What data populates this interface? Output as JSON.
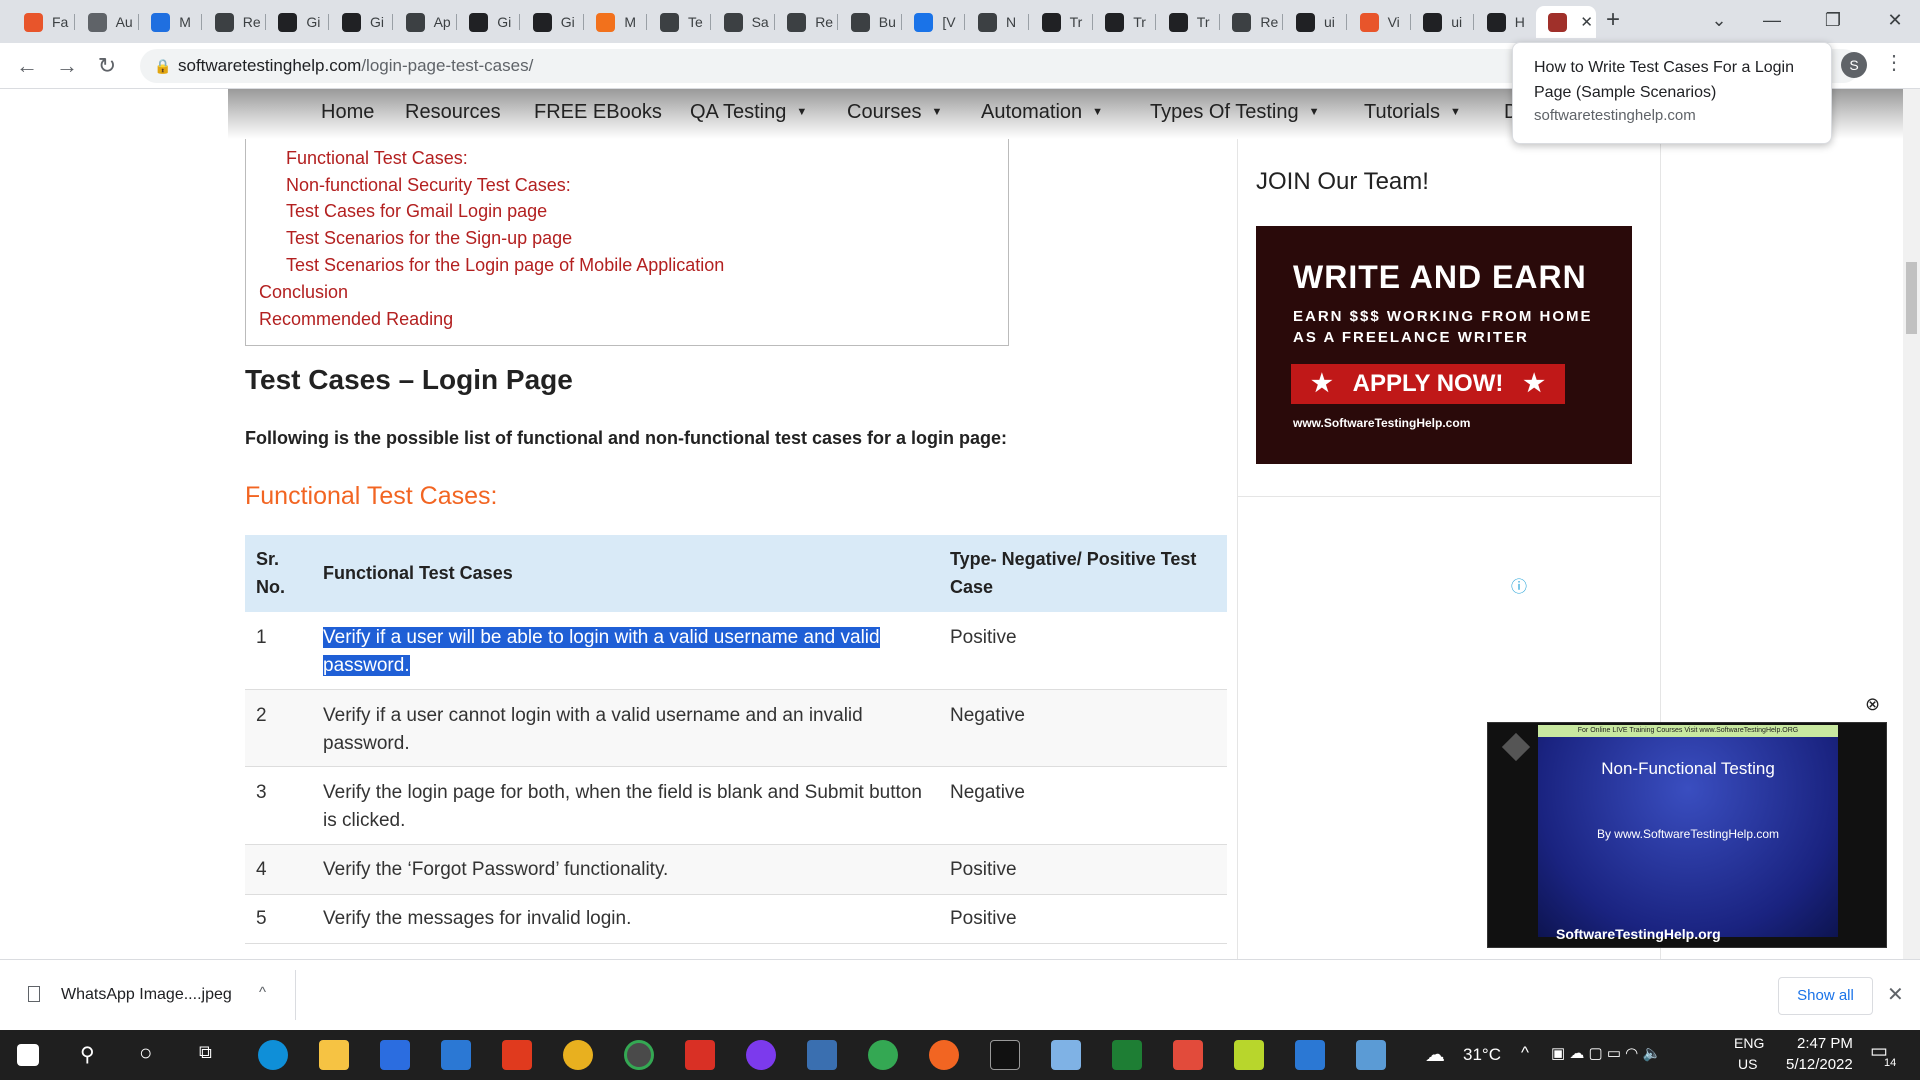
{
  "browser": {
    "tabs": [
      {
        "label": "Fa",
        "icon": "settings-tab-icon",
        "color": "#e8552b"
      },
      {
        "label": "Au",
        "icon": "web-icon",
        "color": "#5f6368"
      },
      {
        "label": "M",
        "icon": "k-icon",
        "color": "#1f6fe0"
      },
      {
        "label": "Re",
        "icon": "tab-icon",
        "color": "#3c4043"
      },
      {
        "label": "Gi",
        "icon": "github-icon",
        "color": "#202124"
      },
      {
        "label": "Gi",
        "icon": "github-icon",
        "color": "#202124"
      },
      {
        "label": "Ap",
        "icon": "tab-icon",
        "color": "#3c4043"
      },
      {
        "label": "Gi",
        "icon": "github-icon",
        "color": "#202124"
      },
      {
        "label": "Gi",
        "icon": "github-icon",
        "color": "#202124"
      },
      {
        "label": "M",
        "icon": "orange-icon",
        "color": "#f2711c"
      },
      {
        "label": "Te",
        "icon": "tab-icon",
        "color": "#3c4043"
      },
      {
        "label": "Sa",
        "icon": "tab-icon",
        "color": "#3c4043"
      },
      {
        "label": "Re",
        "icon": "tab-icon",
        "color": "#3c4043"
      },
      {
        "label": "Bu",
        "icon": "tab-icon",
        "color": "#3c4043"
      },
      {
        "label": "[V",
        "icon": "diamond-icon",
        "color": "#1a73e8"
      },
      {
        "label": "N",
        "icon": "tab-icon",
        "color": "#3c4043"
      },
      {
        "label": "Tr",
        "icon": "tab-icon",
        "color": "#202124"
      },
      {
        "label": "Tr",
        "icon": "tab-icon",
        "color": "#202124"
      },
      {
        "label": "Tr",
        "icon": "tab-icon",
        "color": "#202124"
      },
      {
        "label": "Re",
        "icon": "tab-icon",
        "color": "#3c4043"
      },
      {
        "label": "ui",
        "icon": "github-icon",
        "color": "#202124"
      },
      {
        "label": "Vi",
        "icon": "colorful-icon",
        "color": "#e8552b"
      },
      {
        "label": "ui",
        "icon": "github-icon",
        "color": "#202124"
      },
      {
        "label": "H",
        "icon": "sth-icon",
        "color": "#202124"
      }
    ],
    "active_tab_icon_color": "#a0302a",
    "url_host": "softwaretestinghelp.com",
    "url_path": "/login-page-test-cases/",
    "profile_initial": "S",
    "tooltip": {
      "title": "How to Write Test Cases For a Login Page (Sample Scenarios)",
      "domain": "softwaretestinghelp.com"
    }
  },
  "site_nav": {
    "items": [
      "Home",
      "Resources",
      "FREE EBooks",
      "QA Testing",
      "Courses",
      "Automation",
      "Types Of Testing",
      "Tutorials",
      "D"
    ]
  },
  "toc": {
    "links": [
      "Functional Test Cases:",
      "Non-functional Security Test Cases:",
      "Test Cases for Gmail Login page",
      "Test Scenarios for the Sign-up page",
      "Test Scenarios for the Login page of Mobile Application",
      "Conclusion",
      "Recommended Reading"
    ]
  },
  "article": {
    "heading": "Test Cases – Login Page",
    "intro": "Following is the possible list of functional and non-functional test cases for a login page:",
    "subheading": "Functional Test Cases:",
    "table": {
      "headers": [
        "Sr. No.",
        "Functional Test Cases",
        "Type- Negative/ Positive Test Case"
      ],
      "rows": [
        {
          "no": "1",
          "case": "Verify if a user will be able to login with a valid username and valid password.",
          "type": "Positive"
        },
        {
          "no": "2",
          "case": "Verify if a user cannot login with a valid username and an invalid password.",
          "type": "Negative"
        },
        {
          "no": "3",
          "case": "Verify the login page for both, when the field is blank and Submit button is clicked.",
          "type": "Negative"
        },
        {
          "no": "4",
          "case": "Verify the ‘Forgot Password’ functionality.",
          "type": "Positive"
        },
        {
          "no": "5",
          "case": "Verify the messages for invalid login.",
          "type": "Positive"
        }
      ]
    }
  },
  "sidebar": {
    "join_title": "JOIN Our Team!",
    "ad": {
      "title": "WRITE AND EARN",
      "sub1": "EARN $$$ WORKING FROM HOME",
      "sub2": "AS A FREELANCE WRITER",
      "button": "APPLY NOW!",
      "url": "www.SoftwareTestingHelp.com"
    }
  },
  "video": {
    "top_banner": "For Online LIVE Training Courses Visit www.SoftwareTestingHelp.ORG",
    "title": "Non-Functional Testing",
    "byline": "By www.SoftwareTestingHelp.com",
    "brand": "SoftwareTestingHelp.org"
  },
  "downloads": {
    "file": "WhatsApp Image....jpeg",
    "show_all": "Show all"
  },
  "taskbar": {
    "temperature": "31°C",
    "lang": "ENG",
    "region": "US",
    "time": "2:47 PM",
    "date": "5/12/2022",
    "notifications": "14"
  }
}
